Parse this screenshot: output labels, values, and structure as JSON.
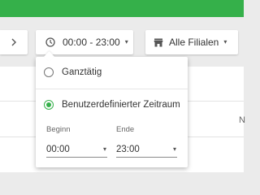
{
  "colors": {
    "accent": "#35b04a"
  },
  "toolbar": {
    "next_icon": "›",
    "time_icon": "clock-icon",
    "time_range": "00:00 - 23:00",
    "stores_icon": "store-icon",
    "stores_label": "Alle Filialen",
    "caret": "▾"
  },
  "table": {
    "edge_text": "N"
  },
  "time_dropdown": {
    "options": [
      {
        "label": "Ganztätig",
        "selected": false
      },
      {
        "label": "Benutzerdefinierter Zeitraum",
        "selected": true
      }
    ],
    "start": {
      "label": "Beginn",
      "value": "00:00"
    },
    "end": {
      "label": "Ende",
      "value": "23:00"
    },
    "caret": "▾"
  }
}
